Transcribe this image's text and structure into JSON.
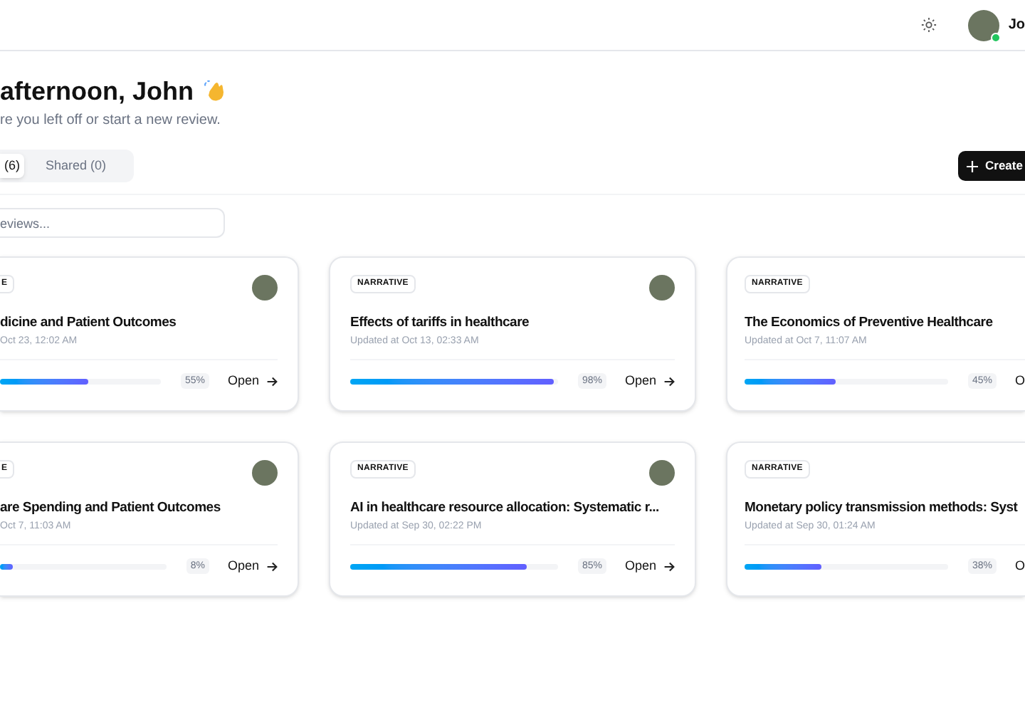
{
  "header": {
    "user_name": "Jo"
  },
  "greeting": {
    "title": "afternoon, John",
    "subtitle": "re you left off or start a new review."
  },
  "tabs": [
    {
      "label": "(6)",
      "selected": true
    },
    {
      "label": "Shared (0)",
      "selected": false
    }
  ],
  "create_button": "Create",
  "search": {
    "placeholder": "eviews..."
  },
  "cards": [
    {
      "tag": "E",
      "title": "dicine and Patient Outcomes",
      "updated": "Oct 23, 12:02 AM",
      "level": 0.55,
      "percent": "55%",
      "action": "Open",
      "avatar": true
    },
    {
      "tag": "NARRATIVE",
      "title": "Effects of tariffs in healthcare",
      "updated": "Updated at Oct 13, 02:33 AM",
      "level": 0.98,
      "percent": "98%",
      "action": "Open",
      "avatar": true
    },
    {
      "tag": "NARRATIVE",
      "title": "The Economics of Preventive Healthcare",
      "updated": "Updated at Oct 7, 11:07 AM",
      "level": 0.45,
      "percent": "45%",
      "action": "O",
      "avatar": false
    },
    {
      "tag": "E",
      "title": "are Spending and Patient Outcomes",
      "updated": "Oct 7, 11:03 AM",
      "level": 0.08,
      "percent": "8%",
      "action": "Open",
      "avatar": true
    },
    {
      "tag": "NARRATIVE",
      "title": "AI in healthcare resource allocation: Systematic r...",
      "updated": "Updated at Sep 30, 02:22 PM",
      "level": 0.85,
      "percent": "85%",
      "action": "Open",
      "avatar": true
    },
    {
      "tag": "NARRATIVE",
      "title": "Monetary policy transmission methods: Syst",
      "updated": "Updated at Sep 30, 01:24 AM",
      "level": 0.38,
      "percent": "38%",
      "action": "O",
      "avatar": false
    }
  ]
}
